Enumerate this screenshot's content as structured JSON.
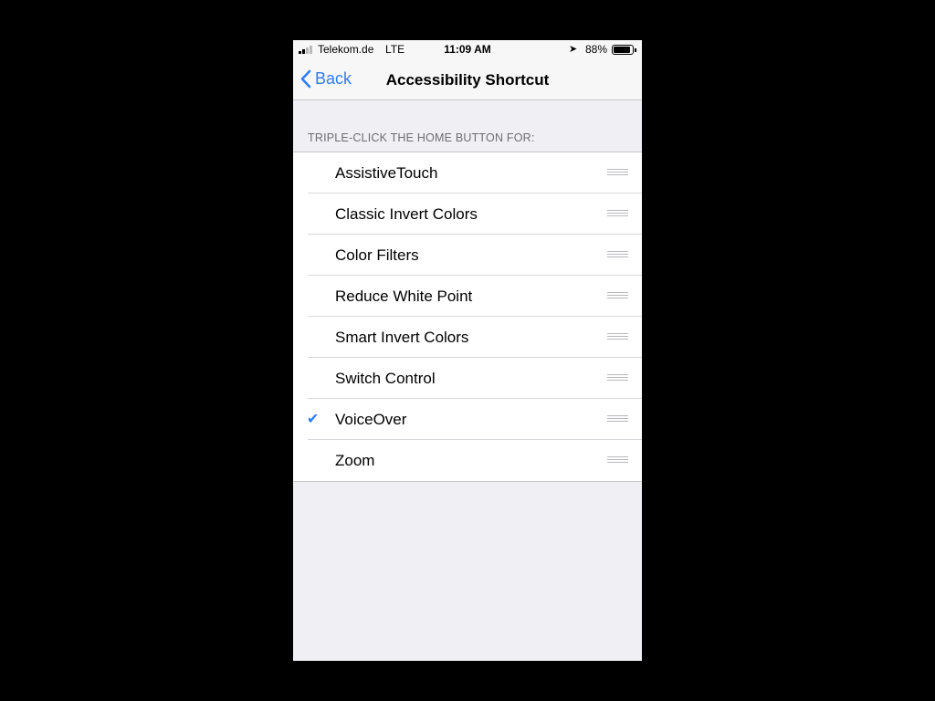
{
  "status": {
    "carrier": "Telekom.de",
    "network": "LTE",
    "time": "11:09 AM",
    "battery": "88%",
    "battery_level": 0.88
  },
  "nav": {
    "back_label": "Back",
    "title": "Accessibility Shortcut"
  },
  "section_header": "TRIPLE-CLICK THE HOME BUTTON FOR:",
  "items": [
    {
      "label": "AssistiveTouch",
      "checked": false
    },
    {
      "label": "Classic Invert Colors",
      "checked": false
    },
    {
      "label": "Color Filters",
      "checked": false
    },
    {
      "label": "Reduce White Point",
      "checked": false
    },
    {
      "label": "Smart Invert Colors",
      "checked": false
    },
    {
      "label": "Switch Control",
      "checked": false
    },
    {
      "label": "VoiceOver",
      "checked": true
    },
    {
      "label": "Zoom",
      "checked": false
    }
  ],
  "accent": "#2f7cf6"
}
